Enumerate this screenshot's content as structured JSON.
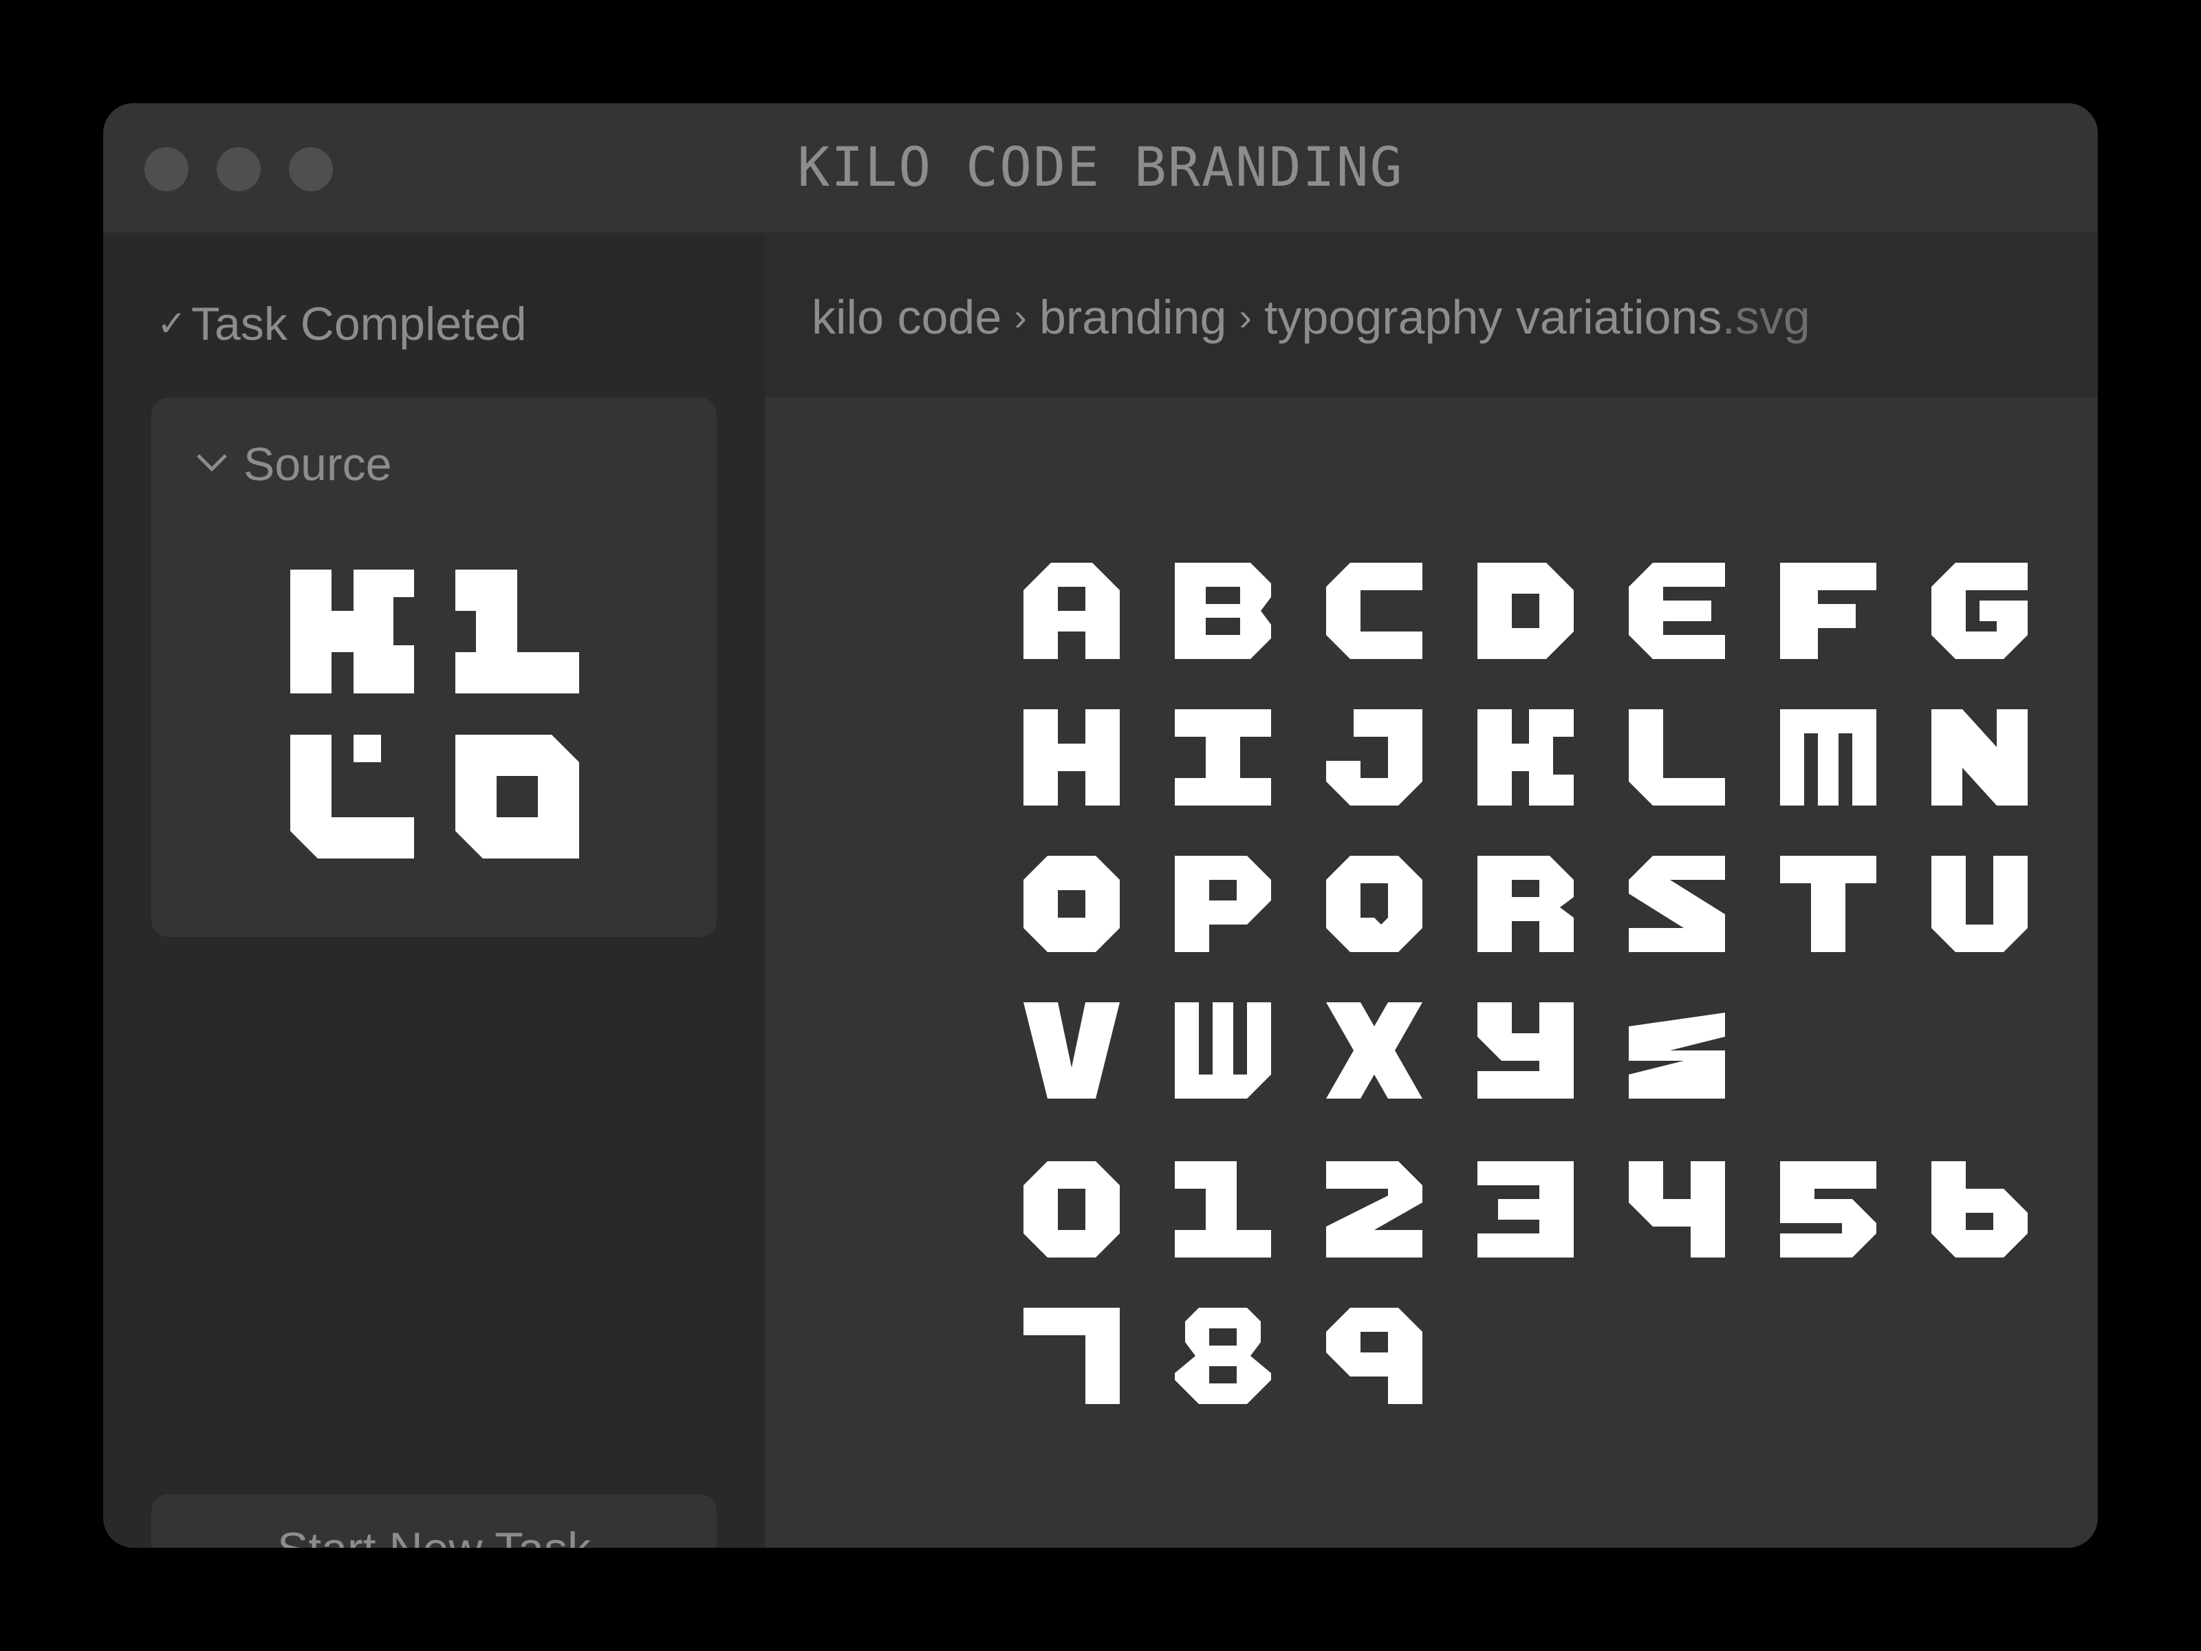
{
  "window": {
    "title": "KILO CODE BRANDING"
  },
  "sidebar": {
    "task_status": "Task Completed",
    "source_label": "Source",
    "new_task_label": "Start New Task"
  },
  "breadcrumb": {
    "items": [
      "kilo code",
      "branding",
      "typography variations"
    ],
    "file_ext": ".svg"
  },
  "glyphs": {
    "letters": [
      "A",
      "B",
      "C",
      "D",
      "E",
      "F",
      "G",
      "H",
      "I",
      "J",
      "K",
      "L",
      "M",
      "N",
      "O",
      "P",
      "Q",
      "R",
      "S",
      "T",
      "U",
      "V",
      "W",
      "X",
      "Y",
      "Z"
    ],
    "digits": [
      "0",
      "1",
      "2",
      "3",
      "4",
      "5",
      "6",
      "7",
      "8",
      "9"
    ]
  },
  "icons": [
    "check-icon",
    "chevron-down-icon",
    "chevron-right-icon",
    "kilo-logo"
  ],
  "colors": {
    "background": "#333436",
    "sidebar": "#28292a",
    "glyph": "#ffffff",
    "text_muted": "#8c8d8f"
  }
}
